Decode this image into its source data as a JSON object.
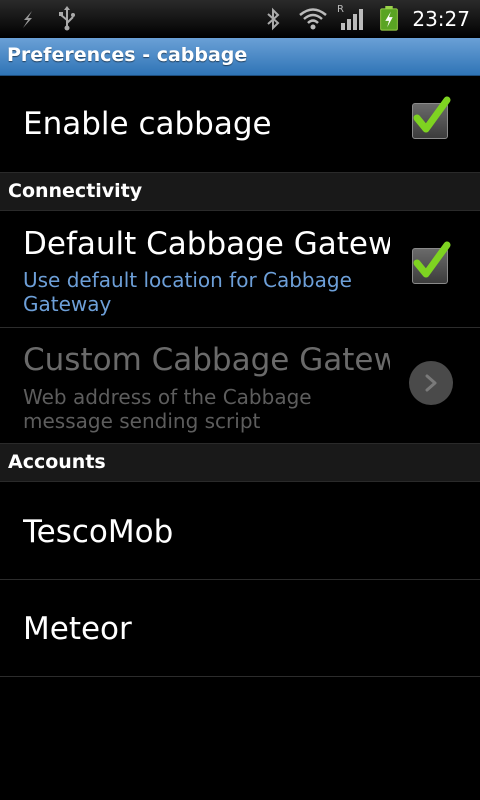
{
  "status_bar": {
    "time": "23:27",
    "icons": [
      "usb-debug-icon",
      "usb-icon",
      "bluetooth-icon",
      "wifi-icon",
      "signal-icon",
      "battery-charging-icon"
    ],
    "roaming_label": "R"
  },
  "titlebar": {
    "title": "Preferences - cabbage",
    "color": "#3f83c4"
  },
  "prefs": {
    "enable": {
      "title": "Enable cabbage",
      "checked": true
    },
    "connectivity_header": "Connectivity",
    "default_gateway": {
      "title": "Default Cabbage Gateway",
      "summary": "Use default location for Cabbage Gateway",
      "checked": true
    },
    "custom_gateway": {
      "title": "Custom Cabbage Gateway",
      "summary": "Web address of the Cabbage message sending script",
      "enabled": false
    },
    "accounts_header": "Accounts",
    "accounts": [
      {
        "name": "TescoMob"
      },
      {
        "name": "Meteor"
      }
    ]
  },
  "colors": {
    "summary_blue": "#6d9fd8",
    "check_green": "#7ed321"
  }
}
